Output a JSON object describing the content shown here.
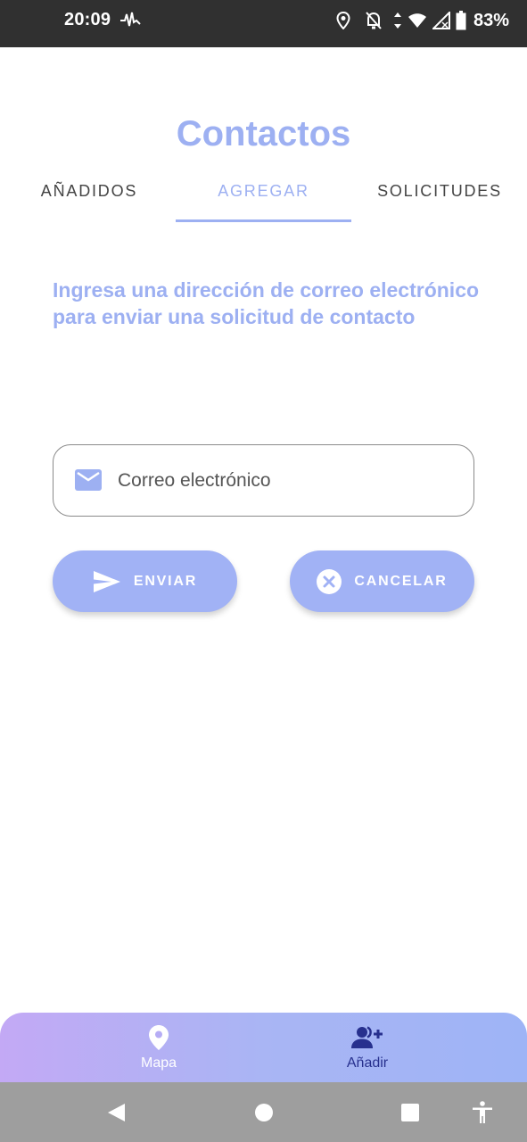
{
  "status_bar": {
    "time": "20:09",
    "battery": "83%",
    "icons": [
      "activity-icon",
      "location-icon",
      "notifications-off-icon",
      "data-arrows-icon",
      "wifi-icon",
      "signal-icon",
      "battery-icon"
    ]
  },
  "header": {
    "title": "Contactos"
  },
  "tabs": [
    {
      "label": "AÑADIDOS",
      "active": false
    },
    {
      "label": "AGREGAR",
      "active": true
    },
    {
      "label": "SOLICITUDES",
      "active": false
    }
  ],
  "main": {
    "instructions": "Ingresa una dirección de correo electrónico para enviar una solicitud de contacto",
    "email_field": {
      "placeholder": "Correo electrónico",
      "value": "",
      "icon": "email-icon"
    },
    "send_button": {
      "label": "ENVIAR",
      "icon": "send-icon"
    },
    "cancel_button": {
      "label": "CANCELAR",
      "icon": "cancel-circle-icon"
    }
  },
  "bottom_nav": {
    "items": [
      {
        "label": "Mapa",
        "icon": "map-pin-icon",
        "selected": false
      },
      {
        "label": "Añadir",
        "icon": "add-user-icon",
        "selected": true
      }
    ]
  },
  "system_nav": {
    "buttons": [
      "back-icon",
      "home-icon",
      "recents-icon",
      "accessibility-icon"
    ]
  },
  "colors": {
    "accent": "#9db0f2",
    "button": "#a1b2f5",
    "nav_gradient_start": "#c3a9f5",
    "nav_gradient_end": "#9eb4f6",
    "nav_selected": "#27308e",
    "status_bar": "#303030",
    "system_bar": "#9e9e9e"
  }
}
